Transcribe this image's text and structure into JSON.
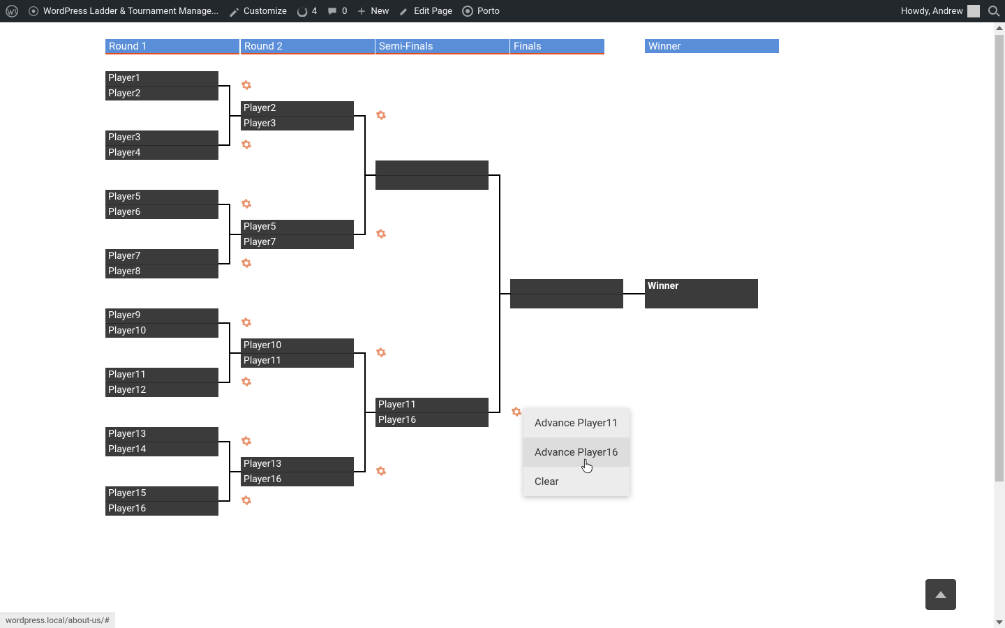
{
  "adminbar": {
    "site_title": "WordPress Ladder & Tournament Manage...",
    "customize": "Customize",
    "updates_count": "4",
    "comments_count": "0",
    "new_label": "New",
    "edit_page": "Edit Page",
    "theme_label": "Porto",
    "howdy": "Howdy, Andrew"
  },
  "rounds": {
    "r1": "Round 1",
    "r2": "Round 2",
    "r3": "Semi-Finals",
    "r4": "Finals",
    "r5": "Winner"
  },
  "r1": {
    "m1": {
      "p1": "Player1",
      "p2": "Player2"
    },
    "m2": {
      "p1": "Player3",
      "p2": "Player4"
    },
    "m3": {
      "p1": "Player5",
      "p2": "Player6"
    },
    "m4": {
      "p1": "Player7",
      "p2": "Player8"
    },
    "m5": {
      "p1": "Player9",
      "p2": "Player10"
    },
    "m6": {
      "p1": "Player11",
      "p2": "Player12"
    },
    "m7": {
      "p1": "Player13",
      "p2": "Player14"
    },
    "m8": {
      "p1": "Player15",
      "p2": "Player16"
    }
  },
  "r2": {
    "m1": {
      "p1": "Player2",
      "p2": "Player3"
    },
    "m2": {
      "p1": "Player5",
      "p2": "Player7"
    },
    "m3": {
      "p1": "Player10",
      "p2": "Player11"
    },
    "m4": {
      "p1": "Player13",
      "p2": "Player16"
    }
  },
  "r3": {
    "m1": {
      "p1": "",
      "p2": ""
    },
    "m2": {
      "p1": "Player11",
      "p2": "Player16"
    }
  },
  "r4": {
    "m1": {
      "p1": "",
      "p2": ""
    }
  },
  "winner_label": "Winner",
  "context_menu": {
    "item1": "Advance Player11",
    "item2": "Advance Player16",
    "item3": "Clear"
  },
  "status_url": "wordpress.local/about-us/#"
}
